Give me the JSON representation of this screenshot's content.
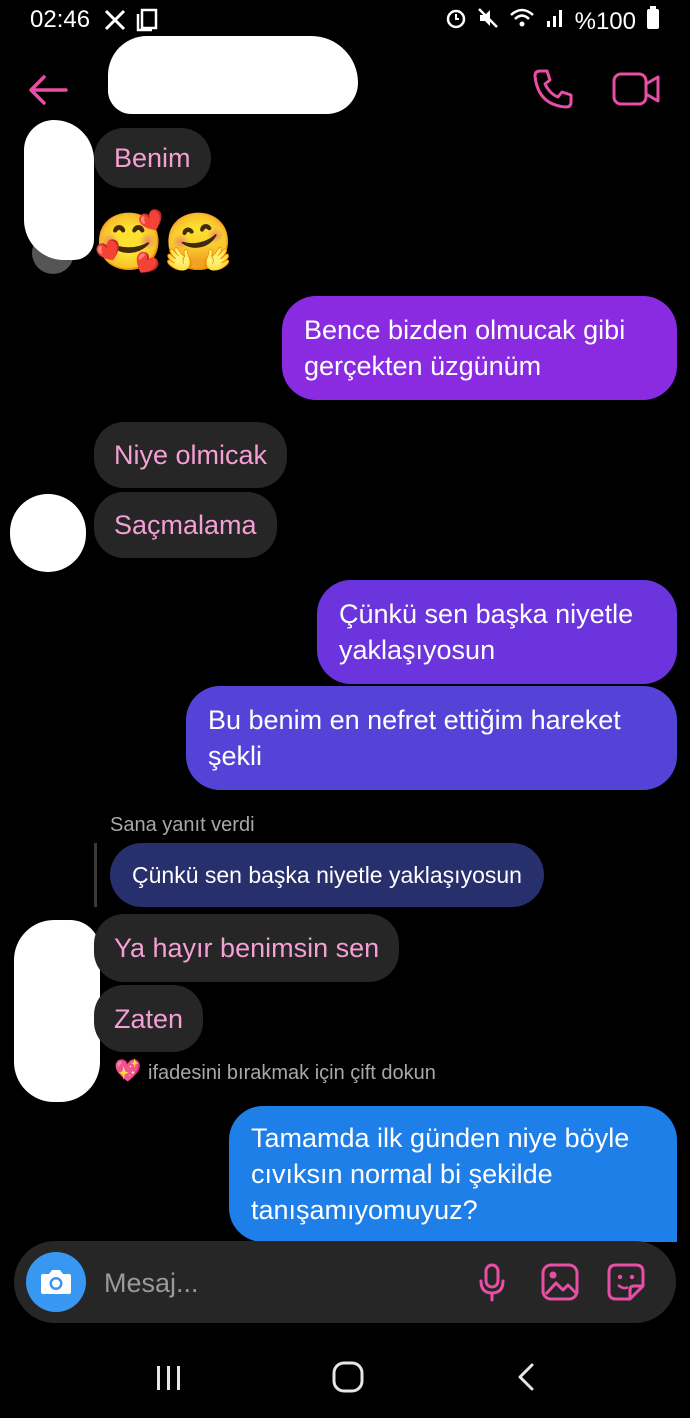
{
  "status_bar": {
    "time": "02:46",
    "battery": "%100",
    "left_icons": [
      "x-logo-icon",
      "copy-icon"
    ],
    "right_icons": [
      "alarm-icon",
      "mute-icon",
      "wifi-icon",
      "signal-icon",
      "battery-icon"
    ]
  },
  "header": {
    "icons": [
      "back-arrow-icon",
      "phone-icon",
      "video-camera-icon"
    ],
    "accent_color": "#e94ea5"
  },
  "messages": {
    "m1": "Benim",
    "m2_emoji": "🥰🤗",
    "m3": "Bence bizden olmucak gibi gerçekten üzgünüm",
    "m4": "Niye olmicak",
    "m5": "Saçmalama",
    "m6": "Çünkü sen başka niyetle yaklaşıyosun",
    "m7": "Bu benim en nefret ettiğim hareket şekli",
    "reply_label": "Sana yanıt verdi",
    "reply_quote": "Çünkü sen başka niyetle yaklaşıyosun",
    "m8": "Ya hayır benimsin sen",
    "m9": "Zaten",
    "react_hint_emoji": "💖",
    "react_hint": "ifadesini bırakmak için çift dokun",
    "m10": "Tamamda ilk günden niye böyle cıvıksın normal bi şekilde tanışamıyomuyuz?"
  },
  "composer": {
    "placeholder": "Mesaj...",
    "icons": [
      "camera-icon",
      "microphone-icon",
      "gallery-icon",
      "sticker-icon"
    ]
  },
  "nav_bar": {
    "icons": [
      "recents-icon",
      "home-icon",
      "back-icon"
    ]
  },
  "colors": {
    "incoming_bg": "#262626",
    "incoming_text": "#f59fd6",
    "outgoing_purple": "#8a2be2",
    "outgoing_indigo": "#5d3fd8",
    "outgoing_blue": "#1f7fe8"
  }
}
